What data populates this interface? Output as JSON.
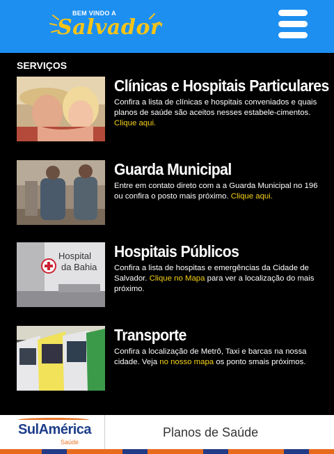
{
  "header": {
    "logo_small": "BEM VINDO A",
    "logo_big": "Salvador"
  },
  "section_title": "SERVIÇOS",
  "services": [
    {
      "title": "Clínicas e Hospitais Particulares",
      "desc": "Confira a lista de clínicas e hospitais conveniados e quais planos de saúde são aceitos nesses estabele-cimentos.",
      "link": "Clique aqui.",
      "desc_after": "",
      "image": "mother-and-child-photo"
    },
    {
      "title": "Guarda Municipal",
      "desc": "Entre em contato direto com a a Guarda Municipal no 196 ou confira o posto mais próximo.",
      "link": "Clique aqui.",
      "desc_after": "",
      "image": "municipal-guards-photo"
    },
    {
      "title": "Hospitais Públicos",
      "desc": "Confira a lista de hospitas e emergências da Cidade de Salvador.",
      "link": "Clique no Mapa",
      "desc_after": "para ver a localização do mais próximo.",
      "image": "hospital-da-bahia-photo",
      "image_text": [
        "Hospital",
        "da Bahia"
      ]
    },
    {
      "title": "Transporte",
      "desc": "Confira a localização de Metrô, Taxi e barcas na nossa cidade. Veja",
      "link": "no nosso mapa",
      "desc_after": "os ponto smais próximos.",
      "image": "buses-photo"
    }
  ],
  "footer": {
    "brand_name": "SulAmérica",
    "brand_sub": "Saúde",
    "plans_label": "Planos de Saúde"
  },
  "colors": {
    "header_bg": "#1d8ff0",
    "accent_yellow": "#f6d21a",
    "brand_blue": "#1d3d8a",
    "brand_orange": "#e8762a"
  }
}
